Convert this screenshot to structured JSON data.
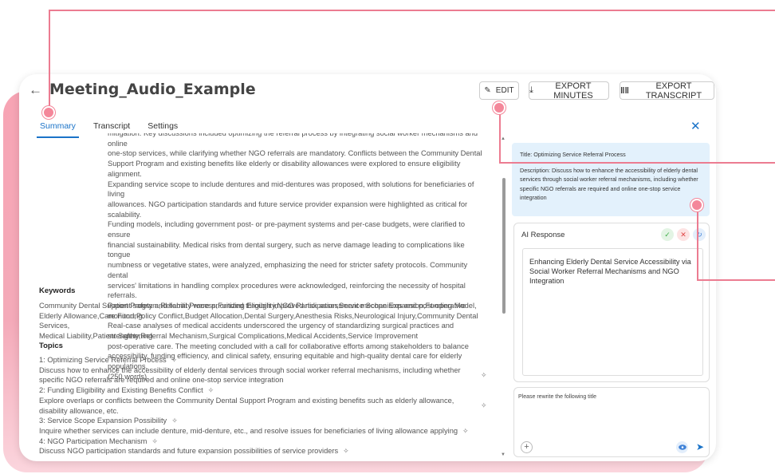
{
  "header": {
    "title": "Meeting_Audio_Example",
    "edit_label": "EDIT",
    "export_minutes_label": "EXPORT MINUTES",
    "export_transcript_label": "EXPORT TRANSCRIPT"
  },
  "tabs": [
    {
      "label": "Summary",
      "active": true
    },
    {
      "label": "Transcript",
      "active": false
    },
    {
      "label": "Settings",
      "active": false
    }
  ],
  "summary": {
    "lines": [
      "mitigation. Key discussions included optimizing the referral process by integrating social worker mechanisms and online",
      "one-stop services, while clarifying whether NGO referrals are mandatory. Conflicts between the Community Dental",
      "Support Program and existing benefits like elderly or disability allowances were explored to ensure eligibility alignment.",
      "Expanding service scope to include dentures and mid-dentures was proposed, with solutions for beneficiaries of living",
      "allowances. NGO participation standards and future service provider expansion were highlighted as critical for scalability.",
      "Funding models, including government post- or pre-payment systems and per-case budgets, were clarified to ensure",
      "financial sustainability. Medical risks from dental surgery, such as nerve damage leading to complications like tongue",
      "numbness or vegetative states, were analyzed, emphasizing the need for stricter safety protocols. Community dental",
      "services' limitations in handling complex procedures were acknowledged, reinforcing the necessity of hospital referrals.",
      "Patient safety and liability were prioritized through improved risk assessment mechanisms and post-operative monitoring.",
      "Real-case analyses of medical accidents underscored the urgency of standardizing surgical practices and strengthening",
      "post-operative care. The meeting concluded with a call for collaborative efforts among stakeholders to balance",
      "accessibility, funding efficiency, and clinical safety, ensuring equitable and high-quality dental care for elderly populations.",
      "(250 words)"
    ]
  },
  "keywords": {
    "heading": "Keywords",
    "lines": [
      "Community Dental Support Program,Referral Process,Funding Eligibility,NGO Participation,Service Scope Expansion,Funding Model,",
      "Elderly Allowance,Care Fund,Policy Conflict,Budget Allocation,Dental Surgery,Anesthesia Risks,Neurological Injury,Community Dental Services,",
      "Medical Liability,Patient Safety,Referral Mechanism,Surgical Complications,Medical Accidents,Service Improvement"
    ]
  },
  "topics": {
    "heading": "Topics",
    "items": [
      {
        "title": "1: Optimizing Service Referral Process",
        "desc": "Discuss how to enhance the accessibility of elderly dental services through social worker referral mechanisms, including whether specific NGO referrals are required and online one-stop service integration"
      },
      {
        "title": "2: Funding Eligibility and Existing Benefits Conflict",
        "desc": "Explore overlaps or conflicts between the Community Dental Support Program and existing benefits such as elderly allowance, disability allowance, etc."
      },
      {
        "title": "3: Service Scope Expansion Possibility",
        "desc": "Inquire whether services can include denture, mid-denture, etc., and resolve issues for beneficiaries of living allowance applying"
      },
      {
        "title": "4: NGO Participation Mechanism",
        "desc": "Discuss NGO participation standards and future expansion possibilities of service providers"
      }
    ]
  },
  "panel": {
    "title_line": "Title: Optimizing Service Referral Process",
    "description_line": "Description: Discuss how to enhance the accessibility of elderly dental services through social worker referral mechanisms, including whether specific NGO referrals are required and online one-stop service integration",
    "ai_label": "AI Response",
    "ai_result": "Enhancing Elderly Dental Service Accessibility via Social Worker Referral Mechanisms and NGO Integration",
    "prompt_text": "Please rewrite the following title"
  },
  "colors": {
    "accent": "#1a73c8",
    "marker": "#f4879a",
    "info_bg": "#e3f1fc"
  }
}
